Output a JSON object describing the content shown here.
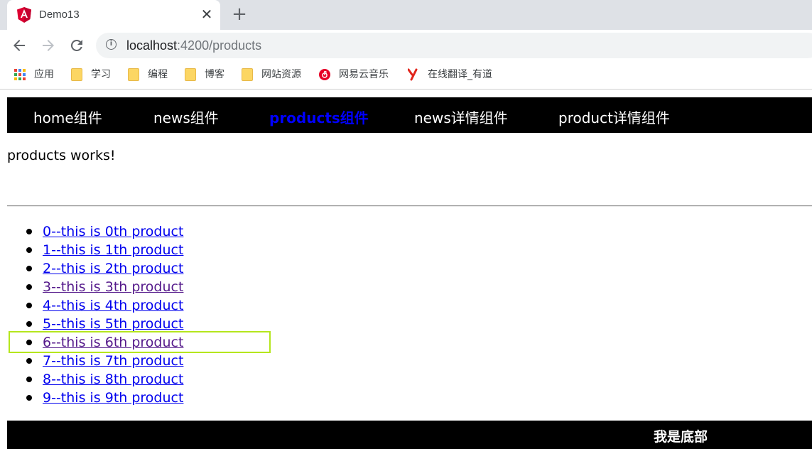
{
  "browser": {
    "tab": {
      "title": "Demo13",
      "favicon": "angular-logo-icon",
      "close_glyph": "✕"
    },
    "new_tab_glyph": "+",
    "url": {
      "host": "localhost",
      "rest": ":4200/products"
    },
    "bookmarks": [
      {
        "label": "应用",
        "icon": "apps-grid-icon"
      },
      {
        "label": "学习",
        "icon": "folder-icon"
      },
      {
        "label": "编程",
        "icon": "folder-icon"
      },
      {
        "label": "博客",
        "icon": "folder-icon"
      },
      {
        "label": "网站资源",
        "icon": "folder-icon"
      },
      {
        "label": "网易云音乐",
        "icon": "netease-music-icon"
      },
      {
        "label": "在线翻译_有道",
        "icon": "youdao-icon"
      }
    ]
  },
  "page": {
    "nav": [
      {
        "label": "home组件",
        "active": false
      },
      {
        "label": "news组件",
        "active": false
      },
      {
        "label": "products组件",
        "active": true
      },
      {
        "label": "news详情组件",
        "active": false
      },
      {
        "label": "product详情组件",
        "active": false
      }
    ],
    "works_text": "products works!",
    "products": [
      {
        "label": "0--this is 0th product",
        "visited": false
      },
      {
        "label": "1--this is 1th product",
        "visited": false
      },
      {
        "label": "2--this is 2th product",
        "visited": false
      },
      {
        "label": "3--this is 3th product",
        "visited": true
      },
      {
        "label": "4--this is 4th product",
        "visited": false
      },
      {
        "label": "5--this is 5th product",
        "visited": false
      },
      {
        "label": "6--this is 6th product",
        "visited": true
      },
      {
        "label": "7--this is 7th product",
        "visited": false
      },
      {
        "label": "8--this is 8th product",
        "visited": false
      },
      {
        "label": "9--this is 9th product",
        "visited": false
      }
    ],
    "highlighted_item": 6,
    "footer": "我是底部"
  },
  "colors": {
    "nav_bg": "#000000",
    "nav_active": "#0000ff",
    "link": "#0000ee",
    "link_visited": "#551a8b",
    "highlight_border": "#b5e61d"
  }
}
